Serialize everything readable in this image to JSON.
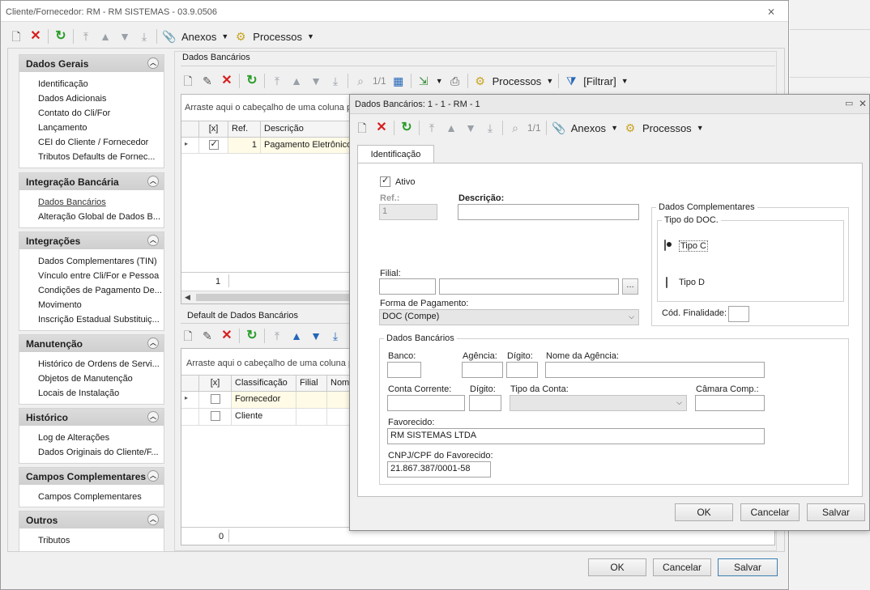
{
  "main_window": {
    "title": "Cliente/Fornecedor: RM - RM SISTEMAS - 03.9.0506",
    "toolbar": {
      "anexos": "Anexos",
      "processos": "Processos"
    },
    "buttons": {
      "ok": "OK",
      "cancelar": "Cancelar",
      "salvar": "Salvar"
    }
  },
  "sidebar": {
    "sections": [
      {
        "title": "Dados Gerais",
        "items": [
          "Identificação",
          "Dados Adicionais",
          "Contato do Cli/For",
          "Lançamento",
          "CEI do Cliente / Fornecedor",
          "Tributos Defaults de Fornec..."
        ]
      },
      {
        "title": "Integração Bancária",
        "items": [
          "Dados Bancários",
          "Alteração Global de Dados B..."
        ]
      },
      {
        "title": "Integrações",
        "items": [
          "Dados Complementares (TIN)",
          "Vínculo entre Cli/For e Pessoa",
          "Condições de Pagamento De...",
          "Movimento",
          "Inscrição Estadual Substituiç..."
        ]
      },
      {
        "title": "Manutenção",
        "items": [
          "Histórico de Ordens de Servi...",
          "Objetos de Manutenção",
          "Locais de Instalação"
        ]
      },
      {
        "title": "Histórico",
        "items": [
          "Log de Alterações",
          "Dados Originais do Cliente/F..."
        ]
      },
      {
        "title": "Campos Complementares",
        "items": [
          "Campos Complementares"
        ]
      },
      {
        "title": "Outros",
        "items": [
          "Tributos"
        ]
      }
    ]
  },
  "dados_bancarios_panel": {
    "title": "Dados Bancários",
    "toolbar": {
      "page": "1/1",
      "processos": "Processos",
      "filtrar": "[Filtrar]"
    },
    "hint": "Arraste aqui o cabeçalho de uma coluna pa",
    "columns": [
      "[x]",
      "Ref.",
      "Descrição"
    ],
    "row": {
      "ref": "1",
      "descricao": "Pagamento Eletrônico"
    },
    "footer_count": "1"
  },
  "default_panel": {
    "title": "Default de Dados Bancários",
    "hint": "Arraste aqui o cabeçalho de uma coluna p",
    "columns": [
      "[x]",
      "Classificação",
      "Filial",
      "Nom"
    ],
    "rows": [
      "Fornecedor",
      "Cliente"
    ],
    "footer_count": "0"
  },
  "dialog": {
    "title": "Dados Bancários: 1 - 1 - RM - 1",
    "toolbar": {
      "page": "1/1",
      "anexos": "Anexos",
      "processos": "Processos"
    },
    "tab": "Identificação",
    "ativo_label": "Ativo",
    "ref_label": "Ref.:",
    "ref_value": "1",
    "descricao_label": "Descrição:",
    "filial_label": "Filial:",
    "forma_pagamento_label": "Forma de Pagamento:",
    "forma_pagamento_value": "DOC (Compe)",
    "dados_complementares": {
      "title": "Dados Complementares",
      "tipo_doc_title": "Tipo do DOC.",
      "tipo_c": "Tipo C",
      "tipo_d": "Tipo D",
      "cod_finalidade_label": "Cód. Finalidade:"
    },
    "dados_bancarios": {
      "title": "Dados Bancários",
      "banco_label": "Banco:",
      "agencia_label": "Agência:",
      "digito_label": "Dígito:",
      "nome_agencia_label": "Nome da Agência:",
      "conta_corrente_label": "Conta Corrente:",
      "digito2_label": "Dígito:",
      "tipo_conta_label": "Tipo da Conta:",
      "camara_label": "Câmara Comp.:",
      "favorecido_label": "Favorecido:",
      "favorecido_value": "RM SISTEMAS LTDA",
      "cnpj_label": "CNPJ/CPF do Favorecido:",
      "cnpj_value": "21.867.387/0001-58"
    },
    "buttons": {
      "ok": "OK",
      "cancelar": "Cancelar",
      "salvar": "Salvar"
    }
  }
}
